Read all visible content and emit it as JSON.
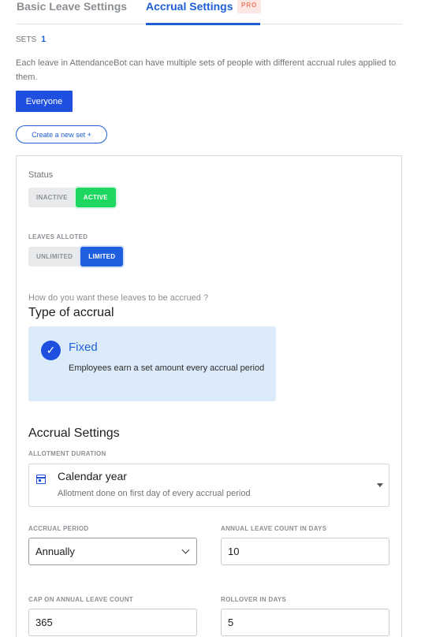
{
  "tabs": [
    {
      "label": "Basic Leave Settings"
    },
    {
      "label": "Accrual Settings",
      "badge": "PRO"
    }
  ],
  "sets": {
    "label": "SETS",
    "count": "1"
  },
  "description": "Each leave in AttendanceBot can have multiple sets of people with different accrual rules applied to them.",
  "set_chip": "Everyone",
  "create_button": "Create a new set +",
  "status": {
    "label": "Status",
    "options": [
      "INACTIVE",
      "ACTIVE"
    ],
    "selected": "ACTIVE"
  },
  "leaves_alloted": {
    "label": "LEAVES ALLOTED",
    "options": [
      "UNLIMITED",
      "LIMITED"
    ],
    "selected": "LIMITED"
  },
  "accrual_type": {
    "question": "How do you want these leaves to be accrued ?",
    "title": "Type of accrual",
    "option_title": "Fixed",
    "option_desc": "Employees earn a set amount every accrual period"
  },
  "accrual_settings": {
    "title": "Accrual Settings",
    "allotment_label": "ALLOTMENT DURATION",
    "allotment_value": "Calendar year",
    "allotment_sub": "Allotment done on first day of every accrual period",
    "accrual_period_label": "ACCRUAL PERIOD",
    "accrual_period_value": "Annually",
    "annual_count_label": "ANNUAL LEAVE COUNT IN DAYS",
    "annual_count_value": "10",
    "cap_label": "CAP ON ANNUAL LEAVE COUNT",
    "cap_value": "365",
    "rollover_label": "ROLLOVER IN DAYS",
    "rollover_value": "5"
  },
  "colors": {
    "accent": "#1e4fdf",
    "active_green": "#1ed760",
    "card_bg": "#dcebfa"
  }
}
